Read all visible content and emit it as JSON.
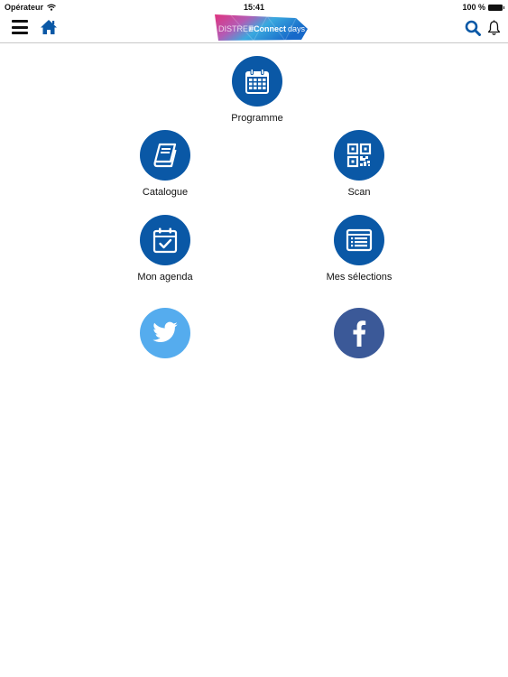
{
  "status_bar": {
    "carrier": "Opérateur",
    "time": "15:41",
    "battery": "100 %"
  },
  "navbar": {
    "logo_text_1": "DISTREE",
    "logo_text_2": "#Connect",
    "logo_text_3": "days"
  },
  "colors": {
    "primary": "#0a58a6",
    "twitter": "#55acee",
    "facebook": "#3b5998"
  },
  "menu": {
    "programme": "Programme",
    "catalogue": "Catalogue",
    "scan": "Scan",
    "agenda": "Mon agenda",
    "selections": "Mes sélections"
  },
  "social": {
    "twitter": "twitter-icon",
    "facebook": "facebook-icon"
  }
}
